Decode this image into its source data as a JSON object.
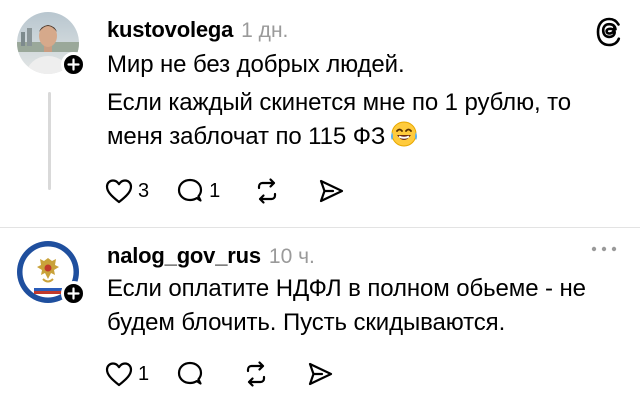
{
  "posts": [
    {
      "username": "kustovolega",
      "time": "1 дн.",
      "paragraphs": [
        [
          "Мир не без добрых людей."
        ],
        [
          "Если каждый скинется мне по 1 рублю, то",
          "меня заблочат по 115 ФЗ"
        ]
      ],
      "emoji": "laughing-face",
      "likes": "3",
      "replies": "1"
    },
    {
      "username": "nalog_gov_rus",
      "time": "10 ч.",
      "paragraphs": [
        [
          "Если оплатите НДФЛ в полном обьеме - не",
          "будем блочить. Пусть скидываются."
        ]
      ],
      "likes": "1",
      "replies": ""
    }
  ],
  "colors": {
    "text": "#000000",
    "muted": "#9a9a9a",
    "thread_line": "#d9d9d9",
    "seal_blue": "#1f4f9e"
  },
  "icons": [
    "threads-logo-icon",
    "more-icon",
    "heart-icon",
    "comment-icon",
    "repost-icon",
    "share-icon",
    "plus-icon"
  ]
}
